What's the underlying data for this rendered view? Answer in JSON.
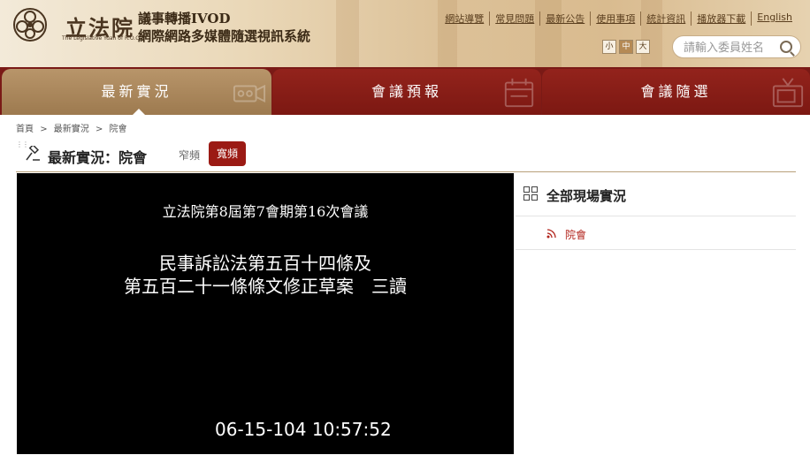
{
  "header": {
    "logo_cn": "立法院",
    "logo_en": "The Legislative Yuan of R.O.C",
    "system_title_line1": "議事轉播IVOD",
    "system_title_line2": "網際網路多媒體隨選視訊系統",
    "links": [
      "網站導覽",
      "常見問題",
      "最新公告",
      "使用事項",
      "統計資訊",
      "播放器下載",
      "English"
    ],
    "font_sizes": [
      "小",
      "中",
      "大"
    ],
    "font_size_selected": "中",
    "search_placeholder": "請輸入委員姓名"
  },
  "nav": {
    "tabs": [
      {
        "label": "最新實況",
        "icon": "camera-icon"
      },
      {
        "label": "會議預報",
        "icon": "calendar-icon"
      },
      {
        "label": "會議隨選",
        "icon": "tv-icon"
      }
    ],
    "active_tab": "最新實況"
  },
  "breadcrumb": [
    "首頁",
    ">",
    "最新實況",
    ">",
    "院會"
  ],
  "page": {
    "title": "最新實況：院會",
    "bandwidth_narrow": "窄頻",
    "bandwidth_wide": "寬頻"
  },
  "video": {
    "line1": "立法院第8屆第7會期第16次會議",
    "line2": "民事訴訟法第五百十四條及",
    "line3": "第五百二十一條條文修正草案　三讀",
    "timestamp": "06-15-104  10:57:52"
  },
  "sidebar": {
    "title": "全部現場實況",
    "items": [
      {
        "label": "院會",
        "icon": "live-broadcast-icon"
      }
    ]
  },
  "colors": {
    "primary": "#7a1a16",
    "active_tab": "#b8956a",
    "accent_red": "#b2241c",
    "wide_button": "#9b1a14"
  }
}
